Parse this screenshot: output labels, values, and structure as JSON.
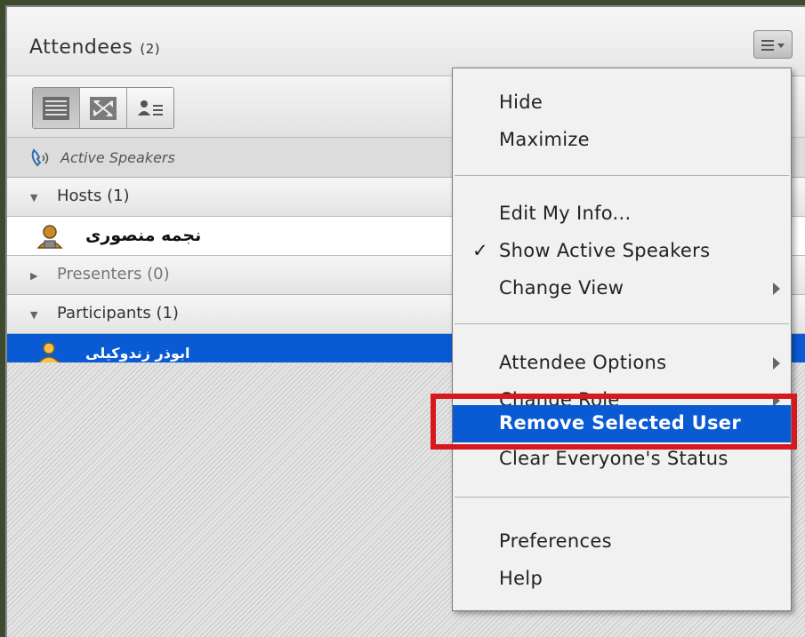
{
  "header": {
    "title": "Attendees",
    "count": "(2)",
    "menu_icon": "hamburger-menu-icon"
  },
  "toolbar": {
    "views": [
      "list-view-icon",
      "grid-view-icon",
      "user-details-icon"
    ]
  },
  "active_speakers": {
    "label": "Active Speakers",
    "icon": "phone-speaker-icon"
  },
  "list": {
    "hosts": {
      "label": "Hosts (1)"
    },
    "host_user": {
      "name": "نجمه منصوری"
    },
    "presenters": {
      "label": "Presenters (0)"
    },
    "participants": {
      "label": "Participants (1)"
    },
    "participant_user": {
      "name": "ابوذر زندوکیلی"
    }
  },
  "menu": {
    "hide": "Hide",
    "maximize": "Maximize",
    "edit_info": "Edit My Info...",
    "show_speakers": "Show Active Speakers",
    "checkmark": "✓",
    "change_view": "Change View",
    "attendee_options": "Attendee Options",
    "change_role": "Change Role",
    "remove_user": "Remove Selected User",
    "clear_status": "Clear Everyone's Status",
    "preferences": "Preferences",
    "help": "Help"
  },
  "colors": {
    "highlight": "#0a5ad4",
    "callout": "#d6181f"
  }
}
